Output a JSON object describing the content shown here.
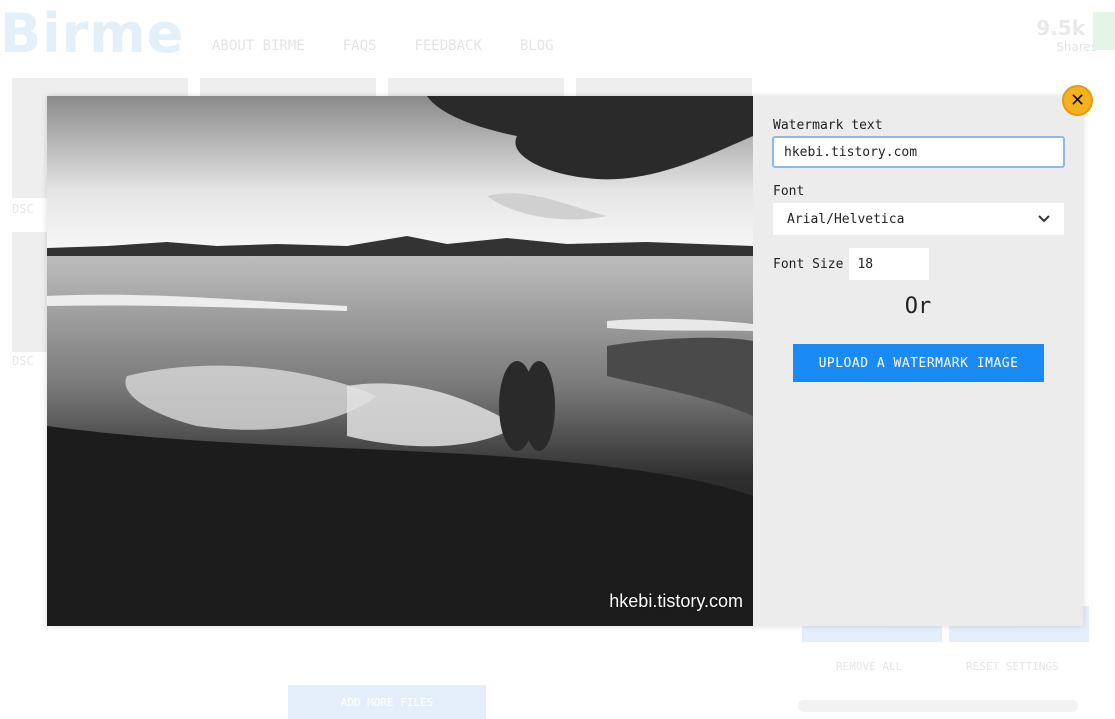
{
  "background": {
    "logo": "Birme",
    "nav": [
      "ABOUT BIRME",
      "FAQS",
      "FEEDBACK",
      "BLOG"
    ],
    "shares_count": "9.5k",
    "shares_label": "Shares",
    "thumb_label": "DSC",
    "add_more_button": "ADD MORE FILES",
    "links": [
      "REMOVE ALL",
      "RESET SETTINGS"
    ]
  },
  "modal": {
    "watermark_label": "Watermark text",
    "watermark_value": "hkebi.tistory.com",
    "font_label": "Font",
    "font_selected": "Arial/Helvetica",
    "font_size_label": "Font Size",
    "font_size_value": "18",
    "or_text": "Or",
    "upload_button": "UPLOAD A WATERMARK IMAGE",
    "photo_watermark": "hkebi.tistory.com",
    "close_icon": "close-icon"
  },
  "colors": {
    "accent_blue": "#1a8af5",
    "close_yellow": "#f4b223",
    "panel_bg": "#ececec"
  }
}
